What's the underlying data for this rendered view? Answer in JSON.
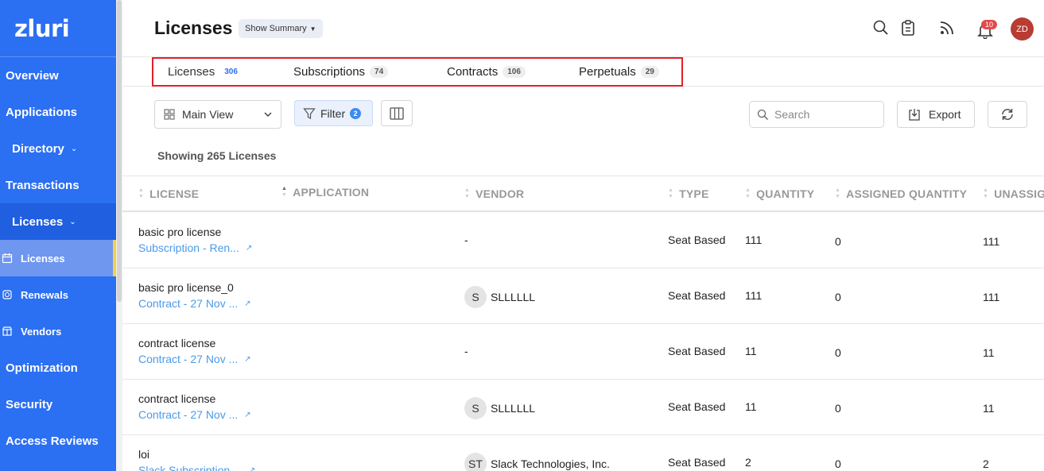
{
  "app": {
    "logo_text": "zluri"
  },
  "sidebar": {
    "items": [
      {
        "label": "Overview"
      },
      {
        "label": "Applications"
      },
      {
        "label": "Directory"
      },
      {
        "label": "Transactions"
      },
      {
        "label": "Licenses"
      },
      {
        "label": "Optimization"
      },
      {
        "label": "Security"
      },
      {
        "label": "Access Reviews"
      }
    ],
    "sub_items": [
      {
        "label": "Licenses",
        "icon": "calendar-icon"
      },
      {
        "label": "Renewals",
        "icon": "renewal-icon"
      },
      {
        "label": "Vendors",
        "icon": "store-icon"
      }
    ]
  },
  "header": {
    "title": "Licenses",
    "summary_label": "Show Summary",
    "notification_count": "10",
    "avatar_initials": "ZD"
  },
  "tabs": [
    {
      "label": "Licenses",
      "count": "306"
    },
    {
      "label": "Subscriptions",
      "count": "74"
    },
    {
      "label": "Contracts",
      "count": "106"
    },
    {
      "label": "Perpetuals",
      "count": "29"
    }
  ],
  "toolbar": {
    "view_label": "Main View",
    "filter_label": "Filter",
    "filter_count": "2",
    "search_placeholder": "Search",
    "export_label": "Export"
  },
  "showing_text": "Showing 265 Licenses",
  "table": {
    "columns": [
      "LICENSE",
      "APPLICATION",
      "VENDOR",
      "TYPE",
      "QUANTITY",
      "ASSIGNED QUANTITY",
      "UNASSIG"
    ],
    "rows": [
      {
        "name": "basic pro license",
        "link": "Subscription - Ren...",
        "vendor_initials": "",
        "vendor": "-",
        "type": "Seat Based",
        "quantity": "111",
        "assigned": "0",
        "unassigned": "111"
      },
      {
        "name": "basic pro license_0",
        "link": "Contract - 27 Nov ...",
        "vendor_initials": "S",
        "vendor": "SLLLLLL",
        "type": "Seat Based",
        "quantity": "111",
        "assigned": "0",
        "unassigned": "111"
      },
      {
        "name": "contract license",
        "link": "Contract - 27 Nov ...",
        "vendor_initials": "",
        "vendor": "-",
        "type": "Seat Based",
        "quantity": "11",
        "assigned": "0",
        "unassigned": "11"
      },
      {
        "name": "contract license",
        "link": "Contract - 27 Nov ...",
        "vendor_initials": "S",
        "vendor": "SLLLLLL",
        "type": "Seat Based",
        "quantity": "11",
        "assigned": "0",
        "unassigned": "11"
      },
      {
        "name": "loi",
        "link": "Slack Subscription ...",
        "vendor_initials": "ST",
        "vendor": "Slack Technologies, Inc.",
        "type": "Seat Based",
        "quantity": "2",
        "assigned": "0",
        "unassigned": "2"
      }
    ]
  },
  "colors": {
    "sidebar": "#2b6ff2",
    "accent_yellow": "#f3d24a",
    "link": "#4a9ae8",
    "highlight_box": "#e0212a",
    "badge_red": "#e24b4b"
  }
}
